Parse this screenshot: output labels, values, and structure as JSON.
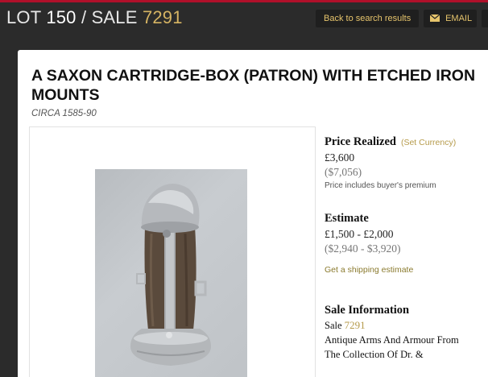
{
  "header": {
    "lot_prefix": "LOT",
    "lot_number": "150",
    "separator": "/",
    "sale_prefix": "SALE",
    "sale_number": "7291",
    "back_label": "Back to search results",
    "email_label": "EMAIL"
  },
  "lot": {
    "title": "A SAXON CARTRIDGE-BOX (PATRON) WITH ETCHED IRON MOUNTS",
    "circa": "CIRCA 1585-90"
  },
  "price_realized": {
    "label": "Price Realized",
    "set_currency": "(Set Currency)",
    "gbp": "£3,600",
    "usd": "($7,056)",
    "note": "Price includes buyer's premium"
  },
  "estimate": {
    "label": "Estimate",
    "gbp": "£1,500 - £2,000",
    "usd": "($2,940 - $3,920)",
    "shipping_link": "Get a shipping estimate"
  },
  "sale_information": {
    "label": "Sale Information",
    "sale_prefix": "Sale",
    "sale_number": "7291",
    "line1": "Antique Arms And Armour From",
    "line2": "The Collection Of Dr. &"
  },
  "colors": {
    "accent_gold": "#d6b463",
    "header_bg": "#2b2b2b",
    "red_line": "#b0102a"
  }
}
